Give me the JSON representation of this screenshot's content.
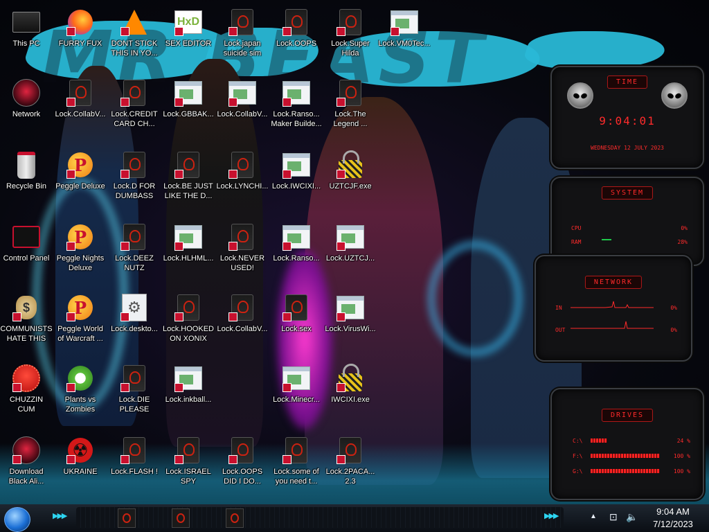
{
  "icons": [
    {
      "label": "This PC",
      "type": "pc"
    },
    {
      "label": "FURRY FUX",
      "type": "firefox"
    },
    {
      "label": "DONT STICK THIS IN YO...",
      "type": "vlc"
    },
    {
      "label": "SEX EDITOR",
      "type": "hxd"
    },
    {
      "label": "Lock.japan suicide sim",
      "type": "lock"
    },
    {
      "label": "Lock.OOPS",
      "type": "lock"
    },
    {
      "label": "Lock.Super Hilda",
      "type": "lock"
    },
    {
      "label": "Lock.VM0Tec...",
      "type": "win"
    },
    {
      "label": "Network",
      "type": "alien"
    },
    {
      "label": "Lock.CollabV...",
      "type": "lock"
    },
    {
      "label": "Lock.CREDIT CARD CH...",
      "type": "lock"
    },
    {
      "label": "Lock.GBBAK...",
      "type": "win"
    },
    {
      "label": "Lock.CollabV...",
      "type": "win"
    },
    {
      "label": "Lock.Ranso... Maker Builde...",
      "type": "win"
    },
    {
      "label": "Lock.The Legend ...",
      "type": "lock"
    },
    {
      "label": "Recycle Bin",
      "type": "bin"
    },
    {
      "label": "Peggle Deluxe",
      "type": "peggle"
    },
    {
      "label": "Lock.D FOR DUMBASS",
      "type": "lock"
    },
    {
      "label": "Lock.BE JUST LIKE THE D...",
      "type": "lock"
    },
    {
      "label": "Lock.LYNCHI...",
      "type": "lock"
    },
    {
      "label": "Lock.IWCIXI...",
      "type": "win"
    },
    {
      "label": "UZTCJF.exe",
      "type": "padlock"
    },
    {
      "label": "Control Panel",
      "type": "cpanel"
    },
    {
      "label": "Peggle Nights Deluxe",
      "type": "peggle"
    },
    {
      "label": "Lock.DEEZ NUTZ",
      "type": "lock"
    },
    {
      "label": "Lock.HLHML...",
      "type": "win"
    },
    {
      "label": "Lock.NEVER USED!",
      "type": "lock"
    },
    {
      "label": "Lock.Ranso...",
      "type": "win"
    },
    {
      "label": "Lock.UZTCJ...",
      "type": "win"
    },
    {
      "label": "COMMUNISTS HATE THIS G...",
      "type": "money"
    },
    {
      "label": "Peggle World of Warcraft ...",
      "type": "peggle"
    },
    {
      "label": "Lock.deskto...",
      "type": "settings"
    },
    {
      "label": "Lock.HOOKED ON XONIX",
      "type": "lock"
    },
    {
      "label": "Lock.CollabV...",
      "type": "lock"
    },
    {
      "label": "Lock.sex",
      "type": "lock"
    },
    {
      "label": "Lock.VirusWi...",
      "type": "win"
    },
    {
      "label": "CHUZZIN CUM",
      "type": "chuzzle"
    },
    {
      "label": "Plants vs Zombies",
      "type": "pvz"
    },
    {
      "label": "Lock.DIE PLEASE",
      "type": "lock"
    },
    {
      "label": "Lock.inkball...",
      "type": "win"
    },
    {
      "label": "Lock.Minecr...",
      "type": "win"
    },
    {
      "label": "IWCIXI.exe",
      "type": "padlock"
    },
    {
      "label": "Download Black Ali...",
      "type": "alien"
    },
    {
      "label": "UKRAINE",
      "type": "radiation"
    },
    {
      "label": "Lock.FLASH !",
      "type": "lock"
    },
    {
      "label": "Lock.ISRAEL SPY",
      "type": "lock"
    },
    {
      "label": "Lock.OOPS DID I DO...",
      "type": "lock"
    },
    {
      "label": "Lock.some of you need t...",
      "type": "lock"
    },
    {
      "label": "Lock.2PACA... 2.3",
      "type": "lock"
    }
  ],
  "wallpaper": {
    "title_text": "MR BEAST"
  },
  "gadgets": {
    "time": {
      "header": "TIME",
      "time": "9:04:01",
      "date": "WEDNESDAY 12 JULY 2023"
    },
    "system": {
      "header": "SYSTEM",
      "cpu_label": "CPU",
      "cpu_value": "0%",
      "ram_label": "RAM",
      "ram_value": "28%",
      "extra_value": "0%"
    },
    "network": {
      "header": "NETWORK",
      "in_label": "IN",
      "in_value": "0%",
      "out_label": "OUT",
      "out_value": "0%"
    },
    "drives": {
      "header": "DRIVES",
      "items": [
        {
          "label": "C:\\",
          "value": "24 %",
          "fill": 0.24
        },
        {
          "label": "F:\\",
          "value": "100 %",
          "fill": 1.0
        },
        {
          "label": "G:\\",
          "value": "100 %",
          "fill": 1.0
        }
      ]
    }
  },
  "taskbar": {
    "time": "9:04 AM",
    "date": "7/12/2023",
    "tasks": [
      "lock-app",
      "lock-app",
      "lock-app"
    ]
  }
}
